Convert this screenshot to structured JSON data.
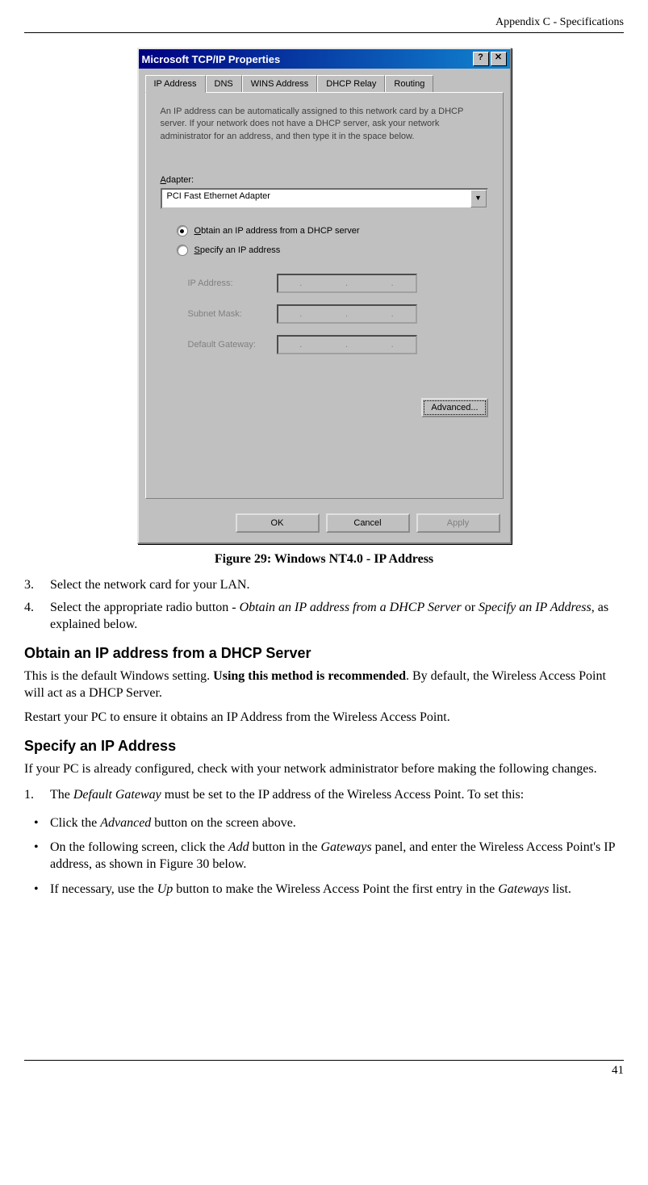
{
  "header": "Appendix C - Specifications",
  "dialog": {
    "title": "Microsoft TCP/IP Properties",
    "help_btn": "?",
    "close_btn": "✕",
    "tabs": [
      "IP Address",
      "DNS",
      "WINS Address",
      "DHCP Relay",
      "Routing"
    ],
    "description": "An IP address can be automatically assigned to this network card by a DHCP server. If your network does not have a DHCP server, ask your network administrator for an address, and then type it in the space below.",
    "adapter_label": "Adapter:",
    "adapter_value": "PCI Fast Ethernet Adapter",
    "radio1": "Obtain an IP address from a DHCP server",
    "radio2": "Specify an IP address",
    "ip_label": "IP Address:",
    "subnet_label": "Subnet Mask:",
    "gateway_label": "Default Gateway:",
    "advanced_btn": "Advanced...",
    "ok_btn": "OK",
    "cancel_btn": "Cancel",
    "apply_btn": "Apply"
  },
  "figure_caption": "Figure 29: Windows NT4.0 - IP Address",
  "step3_num": "3.",
  "step3": "Select the network card for your LAN.",
  "step4_num": "4.",
  "step4_a": "Select the appropriate radio button - ",
  "step4_i1": "Obtain an IP address from a DHCP Server",
  "step4_b": " or ",
  "step4_i2": "Specify an IP Address",
  "step4_c": ", as explained below.",
  "h3_1": "Obtain an IP address from a DHCP Server",
  "p1_a": "This is the default Windows setting. ",
  "p1_b": "Using this method is recommended",
  "p1_c": ". By default, the Wireless Access Point will act as a DHCP Server.",
  "p2": "Restart your PC to ensure it obtains an IP Address from the Wireless Access Point.",
  "h3_2": "Specify an IP Address",
  "p3": "If your PC is already configured, check with your network administrator before making the following changes.",
  "ol1_num": "1.",
  "ol1_a": "The ",
  "ol1_i": "Default Gateway",
  "ol1_b": " must be set to the IP address of the Wireless Access Point. To set this:",
  "b1_a": "Click the ",
  "b1_i": "Advanced",
  "b1_b": " button on the screen above.",
  "b2_a": "On the following screen, click the ",
  "b2_i1": "Add",
  "b2_b": " button in the ",
  "b2_i2": "Gateways",
  "b2_c": " panel, and enter the Wireless Access Point's IP address, as shown in Figure 30 below.",
  "b3_a": "If necessary, use the ",
  "b3_i": "Up",
  "b3_b": " button to make the Wireless Access Point the first entry in the ",
  "b3_i2": "Gateways",
  "b3_c": " list.",
  "page_number": "41"
}
